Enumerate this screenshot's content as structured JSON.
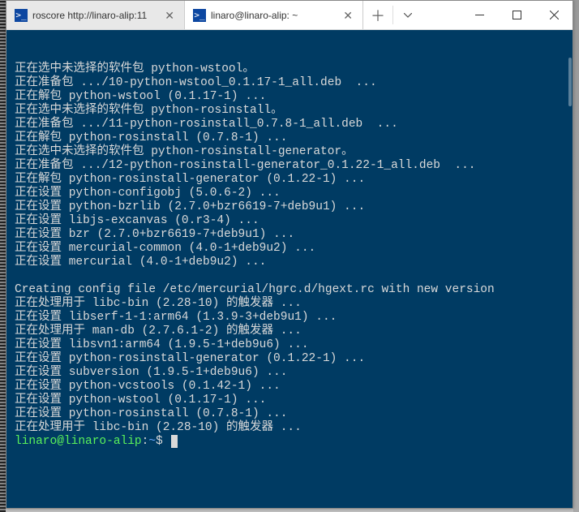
{
  "tabs": [
    {
      "icon": ">_",
      "label": "roscore http://linaro-alip:11"
    },
    {
      "icon": ">_",
      "label": "linaro@linaro-alip: ~"
    }
  ],
  "terminal": {
    "lines": [
      "正在选中未选择的软件包 python-wstool。",
      "正在准备包 .../10-python-wstool_0.1.17-1_all.deb  ...",
      "正在解包 python-wstool (0.1.17-1) ...",
      "正在选中未选择的软件包 python-rosinstall。",
      "正在准备包 .../11-python-rosinstall_0.7.8-1_all.deb  ...",
      "正在解包 python-rosinstall (0.7.8-1) ...",
      "正在选中未选择的软件包 python-rosinstall-generator。",
      "正在准备包 .../12-python-rosinstall-generator_0.1.22-1_all.deb  ...",
      "正在解包 python-rosinstall-generator (0.1.22-1) ...",
      "正在设置 python-configobj (5.0.6-2) ...",
      "正在设置 python-bzrlib (2.7.0+bzr6619-7+deb9u1) ...",
      "正在设置 libjs-excanvas (0.r3-4) ...",
      "正在设置 bzr (2.7.0+bzr6619-7+deb9u1) ...",
      "正在设置 mercurial-common (4.0-1+deb9u2) ...",
      "正在设置 mercurial (4.0-1+deb9u2) ...",
      "",
      "Creating config file /etc/mercurial/hgrc.d/hgext.rc with new version",
      "正在处理用于 libc-bin (2.28-10) 的触发器 ...",
      "正在设置 libserf-1-1:arm64 (1.3.9-3+deb9u1) ...",
      "正在处理用于 man-db (2.7.6.1-2) 的触发器 ...",
      "正在设置 libsvn1:arm64 (1.9.5-1+deb9u6) ...",
      "正在设置 python-rosinstall-generator (0.1.22-1) ...",
      "正在设置 subversion (1.9.5-1+deb9u6) ...",
      "正在设置 python-vcstools (0.1.42-1) ...",
      "正在设置 python-wstool (0.1.17-1) ...",
      "正在设置 python-rosinstall (0.7.8-1) ...",
      "正在处理用于 libc-bin (2.28-10) 的触发器 ..."
    ],
    "prompt": {
      "user_host": "linaro@linaro-alip",
      "sep": ":",
      "path": "~",
      "symbol": "$"
    }
  }
}
